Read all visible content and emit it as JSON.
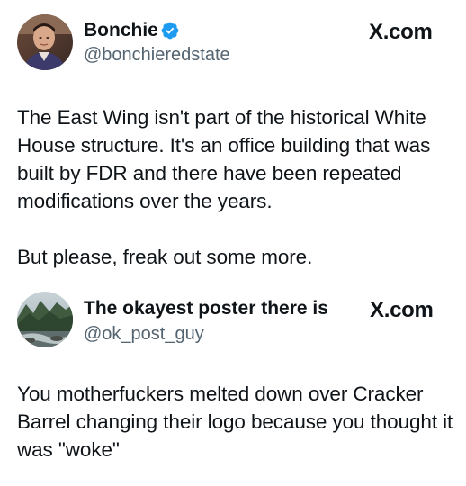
{
  "tweets": [
    {
      "display_name": "Bonchie",
      "verified": true,
      "handle": "@bonchieredstate",
      "source_label": "X.com",
      "text": "The East Wing isn't part of the historical White House structure. It's an office building that was built by FDR and there have been repeated modifications over the years.\n\nBut please, freak out some more.",
      "avatar_icon": "person-avatar-icon"
    },
    {
      "display_name": "The okayest poster there is",
      "verified": false,
      "handle": "@ok_post_guy",
      "source_label": "X.com",
      "text": "You motherfuckers melted down over Cracker Barrel changing their logo because you thought it was \"woke\"",
      "avatar_icon": "landscape-avatar-icon"
    }
  ],
  "colors": {
    "text_primary": "#0f1419",
    "text_secondary": "#536471",
    "verified_blue": "#1d9bf0"
  }
}
